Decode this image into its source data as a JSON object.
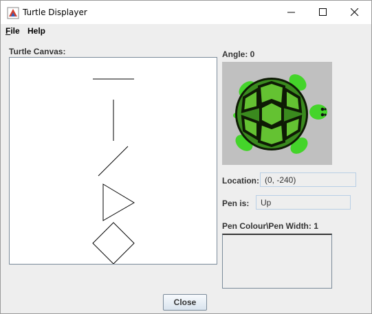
{
  "window": {
    "title": "Turtle Displayer",
    "icon": "turtle-app-icon"
  },
  "menu": {
    "file": {
      "mnemonic": "F",
      "rest": "ile"
    },
    "help": "Help"
  },
  "canvas": {
    "label": "Turtle Canvas:",
    "shapes": [
      "horizontal-line",
      "vertical-line",
      "diagonal-line",
      "triangle",
      "diamond"
    ]
  },
  "info": {
    "angle": "Angle: 0",
    "location_label": "Location:",
    "location_value": "(0, -240)",
    "pen_label": "Pen is:",
    "pen_value": "Up",
    "pen_colour_label": "Pen Colour\\Pen Width: 1"
  },
  "buttons": {
    "close": "Close"
  },
  "colors": {
    "turtle_shell": "#3a8a1e",
    "turtle_limbs": "#44d42a",
    "turtle_bg": "#c0c0c0"
  }
}
